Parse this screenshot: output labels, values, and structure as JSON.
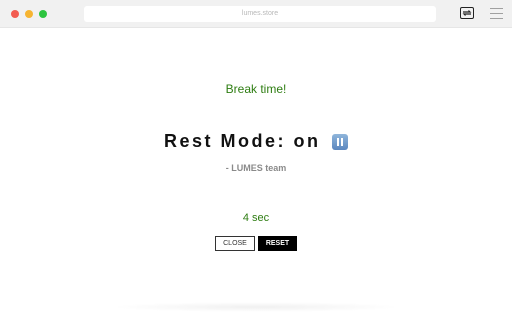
{
  "browser": {
    "url": "lumes.store",
    "extension_icon": "swap-icon",
    "menu_icon": "hamburger-menu-icon"
  },
  "page": {
    "break_text": "Break time!",
    "title": "Rest Mode: on",
    "title_icon": "pause-button-icon",
    "credit": "- LUMES team",
    "timer": "4 sec",
    "close_label": "CLOSE",
    "reset_label": "RESET"
  },
  "colors": {
    "accent_green": "#2e7d12",
    "reset_bg": "#000000"
  }
}
